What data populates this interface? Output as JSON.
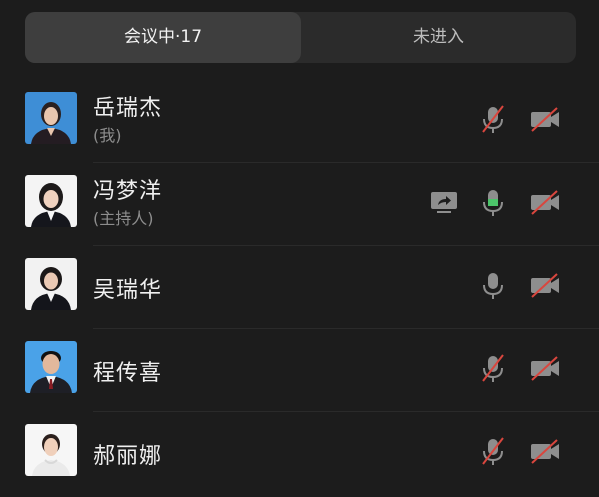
{
  "tabs": {
    "in_meeting": "会议中·17",
    "not_joined": "未进入"
  },
  "participants": [
    {
      "name": "岳瑞杰",
      "subtitle": "(我)",
      "mic": "muted",
      "camera": "off",
      "avatar_bg": "#3e8ed6"
    },
    {
      "name": "冯梦洋",
      "subtitle": "(主持人)",
      "sharing": true,
      "mic": "active",
      "camera": "off",
      "avatar_bg": "#f4f4f4"
    },
    {
      "name": "吴瑞华",
      "mic": "on",
      "camera": "off",
      "avatar_bg": "#f2f2f2"
    },
    {
      "name": "程传喜",
      "mic": "muted",
      "camera": "off",
      "avatar_bg": "#4aa2e8"
    },
    {
      "name": "郝丽娜",
      "mic": "muted",
      "camera": "off",
      "avatar_bg": "#f6f6f6"
    }
  ],
  "colors": {
    "muted_slash": "#d9463e",
    "active_mic": "#4cc46a",
    "icon_gray": "#8e8e8e"
  },
  "icons": [
    "mic-muted-icon",
    "mic-icon",
    "camera-off-icon",
    "screen-share-icon"
  ]
}
